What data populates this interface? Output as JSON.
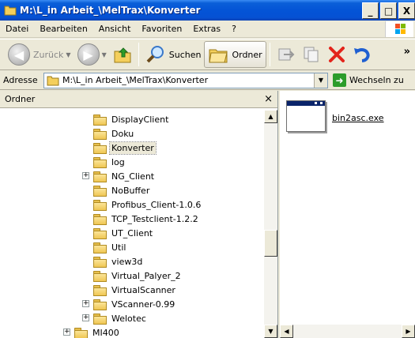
{
  "window": {
    "title": "M:\\L_in Arbeit_\\MelTrax\\Konverter",
    "controls": {
      "minimize": "_",
      "maximize": "□",
      "close": "X"
    }
  },
  "menu": {
    "items": [
      {
        "label": "Datei"
      },
      {
        "label": "Bearbeiten"
      },
      {
        "label": "Ansicht"
      },
      {
        "label": "Favoriten"
      },
      {
        "label": "Extras"
      },
      {
        "label": "?"
      }
    ]
  },
  "toolbar": {
    "back_label": "Zurück",
    "search_label": "Suchen",
    "folders_label": "Ordner",
    "more": "»"
  },
  "address": {
    "label": "Adresse",
    "value": "M:\\L_in Arbeit_\\MelTrax\\Konverter",
    "go_label": "Wechseln zu"
  },
  "left_pane": {
    "title": "Ordner",
    "close": "×",
    "items": [
      {
        "label": "DisplayClient",
        "expander": ""
      },
      {
        "label": "Doku",
        "expander": ""
      },
      {
        "label": "Konverter",
        "expander": "",
        "selected": true
      },
      {
        "label": "log",
        "expander": ""
      },
      {
        "label": "NG_Client",
        "expander": "+"
      },
      {
        "label": "NoBuffer",
        "expander": ""
      },
      {
        "label": "Profibus_Client-1.0.6",
        "expander": ""
      },
      {
        "label": "TCP_Testclient-1.2.2",
        "expander": ""
      },
      {
        "label": "UT_Client",
        "expander": ""
      },
      {
        "label": "Util",
        "expander": ""
      },
      {
        "label": "view3d",
        "expander": ""
      },
      {
        "label": "Virtual_Palyer_2",
        "expander": ""
      },
      {
        "label": "VirtualScanner",
        "expander": ""
      },
      {
        "label": "VScanner-0.99",
        "expander": "+"
      },
      {
        "label": "Welotec",
        "expander": "+"
      },
      {
        "label": "MI400",
        "expander": "+"
      }
    ]
  },
  "right_pane": {
    "files": [
      {
        "name": "bin2asc.exe",
        "icon": "exe-window-icon"
      }
    ]
  },
  "colors": {
    "titlebar": "#0454d6",
    "face": "#ece9d8",
    "folder": "#efc653"
  }
}
